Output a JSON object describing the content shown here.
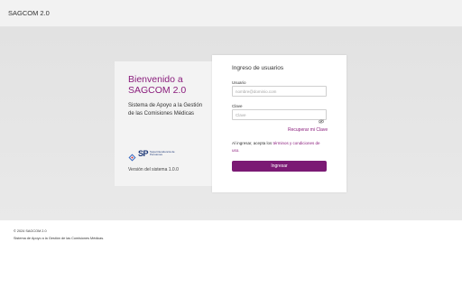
{
  "header": {
    "brand": "SAGCOM 2.0"
  },
  "welcome": {
    "title": "Bienvenido a SAGCOM 2.0",
    "description": "Sistema de Apoyo a la Gestión de las Comisiones Médicas",
    "logo": {
      "letters": "SP",
      "text": "Superintendencia de Pensiones"
    },
    "version": "Versión del sistema 1.0.0"
  },
  "login": {
    "title": "Ingreso de usuarios",
    "username_label": "Usuario",
    "username_placeholder": "nombre@dominio.com",
    "password_label": "Clave",
    "password_placeholder": "Clave",
    "recover_label": "Recuperar mi Clave",
    "terms_prefix": "Al ingresar, acepta los ",
    "terms_link": "términos y condiciones de uso.",
    "submit_label": "Ingresar"
  },
  "footer": {
    "copyright": "© 2024 SAGCOM 2.0",
    "description": "Sistema de Apoyo a la Gestión de las Comisiones Médicas."
  },
  "colors": {
    "accent": "#8a1c7c",
    "button": "#7b1a74",
    "logo_blue": "#1f3a78"
  }
}
